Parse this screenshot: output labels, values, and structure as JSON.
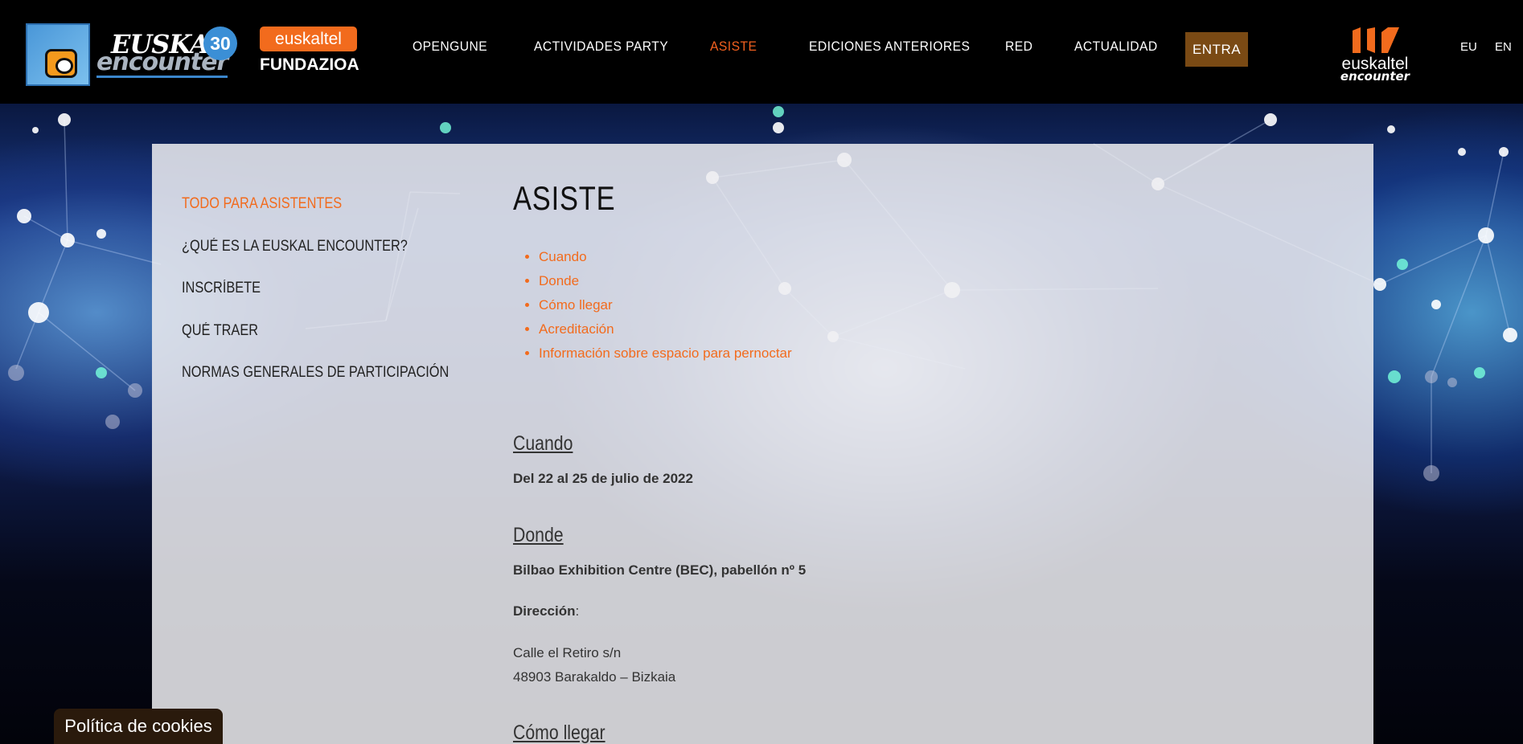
{
  "header": {
    "logo": {
      "line1": "EUSKAL",
      "line2": "encounter",
      "badge": "30"
    },
    "fundazioa": {
      "brand": "euskaltel",
      "name": "FUNDAZIOA"
    },
    "nav": [
      {
        "label": "OPENGUNE"
      },
      {
        "label": "ACTIVIDADES PARTY"
      },
      {
        "label": "ASISTE"
      },
      {
        "label": "EDICIONES ANTERIORES"
      },
      {
        "label": "RED"
      },
      {
        "label": "ACTUALIDAD"
      }
    ],
    "entra": "ENTRA",
    "partner": {
      "line1": "euskaltel",
      "line2": "encounter"
    },
    "langs": [
      "EU",
      "EN"
    ]
  },
  "sidebar": {
    "items": [
      {
        "label": "TODO PARA ASISTENTES"
      },
      {
        "label": "¿QUÉ ES LA EUSKAL ENCOUNTER?"
      },
      {
        "label": "INSCRÍBETE"
      },
      {
        "label": "QUÉ TRAER"
      },
      {
        "label": "NORMAS GENERALES DE PARTICIPACIÓN"
      }
    ]
  },
  "main": {
    "title": "ASISTE",
    "toc": [
      "Cuando",
      "Donde",
      "Cómo llegar",
      "Acreditación",
      "Información sobre espacio para pernoctar"
    ],
    "cuando": {
      "title": "Cuando",
      "text": "Del 22 al 25 de julio de 2022"
    },
    "donde": {
      "title": "Donde",
      "venue": "Bilbao Exhibition Centre (BEC), pabellón nº 5",
      "address_label": "Dirección",
      "address_colon": ":",
      "address_line1": "Calle el Retiro s/n",
      "address_line2": "48903 Barakaldo – Bizkaia"
    },
    "como_llegar": {
      "title": "Cómo llegar"
    }
  },
  "cookie": {
    "label": "Política de cookies"
  },
  "colors": {
    "accent": "#f26b1d",
    "entra_bg": "#7a4a14",
    "header_bg": "#000000"
  }
}
